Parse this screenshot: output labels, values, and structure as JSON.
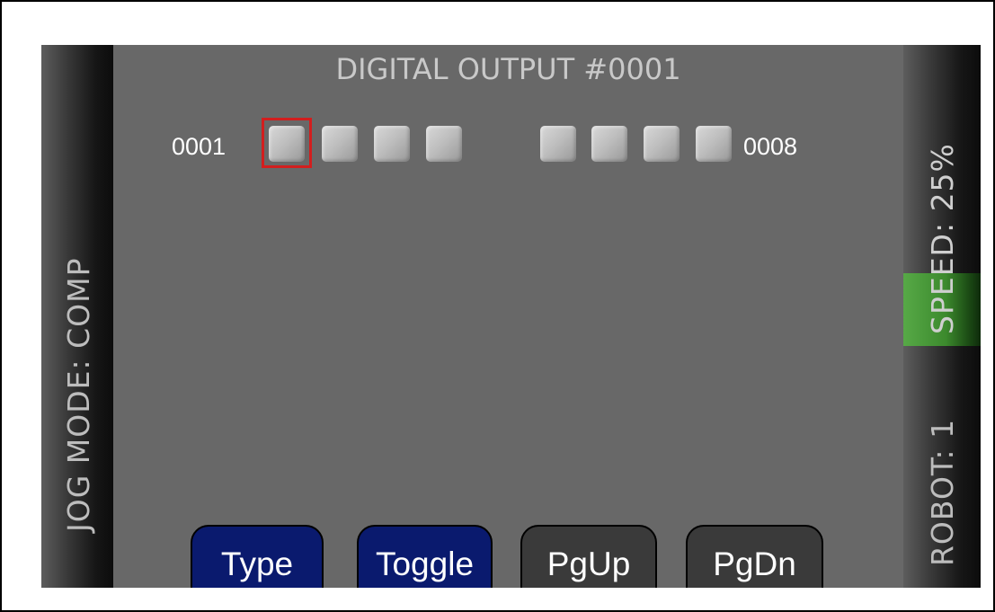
{
  "title": "DIGITAL OUTPUT #0001",
  "status": {
    "jog_mode": "JOG MODE: COMP",
    "speed": "SPEED: 25%",
    "robot": "ROBOT: 1"
  },
  "outputs": {
    "first_label": "0001",
    "last_label": "0008",
    "selected_index": 0,
    "states": [
      false,
      false,
      false,
      false,
      false,
      false,
      false,
      false
    ]
  },
  "softkeys": {
    "type": "Type",
    "toggle": "Toggle",
    "pgup": "PgUp",
    "pgdn": "PgDn"
  },
  "colors": {
    "background": "#686868",
    "speed_indicator": "#3c8a2d",
    "selection": "#d21e1e",
    "active_key": "#0a1a6e",
    "inactive_key": "#3a3a3a"
  }
}
